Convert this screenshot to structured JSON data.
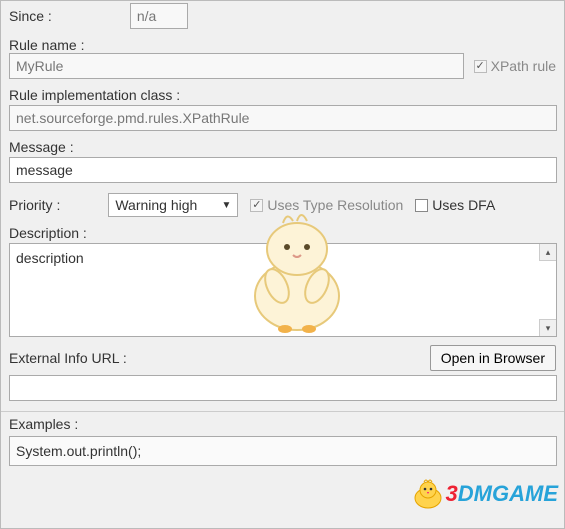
{
  "since": {
    "label": "Since :",
    "value": "n/a"
  },
  "ruleName": {
    "label": "Rule name :",
    "value": "MyRule"
  },
  "xpathRule": {
    "label": "XPath rule",
    "checked": true,
    "disabled": true
  },
  "implClass": {
    "label": "Rule implementation class :",
    "value": "net.sourceforge.pmd.rules.XPathRule"
  },
  "message": {
    "label": "Message :",
    "value": "message"
  },
  "priority": {
    "label": "Priority :",
    "value": "Warning high"
  },
  "usesTypeRes": {
    "label": "Uses Type Resolution",
    "checked": true,
    "disabled": true
  },
  "usesDFA": {
    "label": "Uses DFA",
    "checked": false
  },
  "description": {
    "label": "Description :",
    "value": "description"
  },
  "externalUrl": {
    "label": "External Info URL :",
    "buttonLabel": "Open in Browser",
    "value": ""
  },
  "examples": {
    "label": "Examples :",
    "value": "System.out.println();"
  },
  "watermark": {
    "t1": "3",
    "t2": "DM",
    "t3": "GAME"
  }
}
